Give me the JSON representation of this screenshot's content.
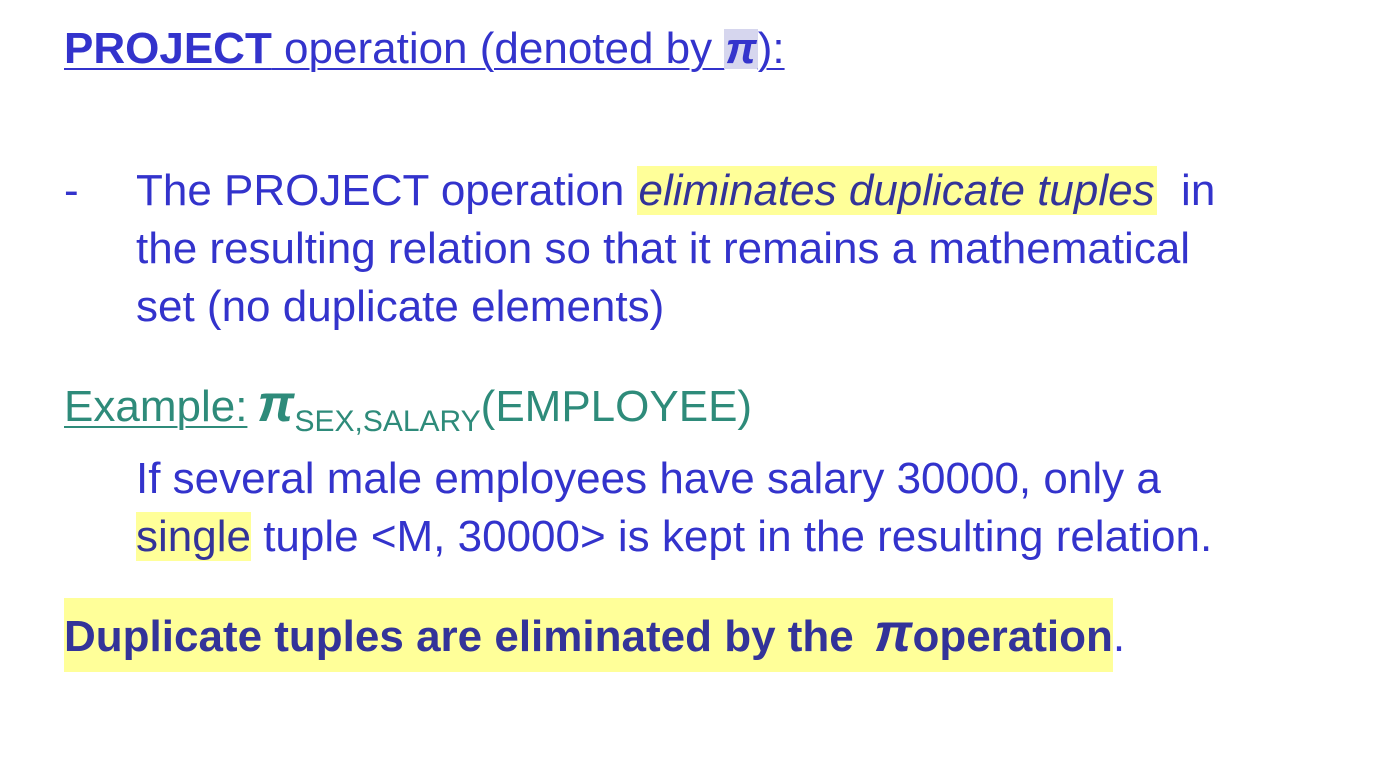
{
  "heading": {
    "bold_word": "PROJECT",
    "text": " operation (denoted by ",
    "symbol": "π",
    "close": "):"
  },
  "bullet": {
    "marker": "-",
    "part1": "The PROJECT operation ",
    "highlight": "eliminates duplicate tuples",
    "part2": "  in",
    "line2": "the resulting relation so that it remains a mathematical",
    "line3": "set (no duplicate elements)"
  },
  "example": {
    "label": "Example:",
    "symbol": "π",
    "subscript": "SEX,SALARY",
    "relation": "(EMPLOYEE)",
    "line1": "If several male employees have salary 30000, only a",
    "highlight": "single",
    "line2_rest": " tuple <M, 30000> is kept in the resulting relation."
  },
  "conclusion": {
    "part1": "Duplicate tuples are eliminated by the ",
    "symbol": "π",
    "part2": "operation",
    "period": "."
  },
  "colors": {
    "text": "#3333cc",
    "dark_text": "#333399",
    "example_label": "#2e8b7a",
    "highlight": "#ffff99"
  }
}
